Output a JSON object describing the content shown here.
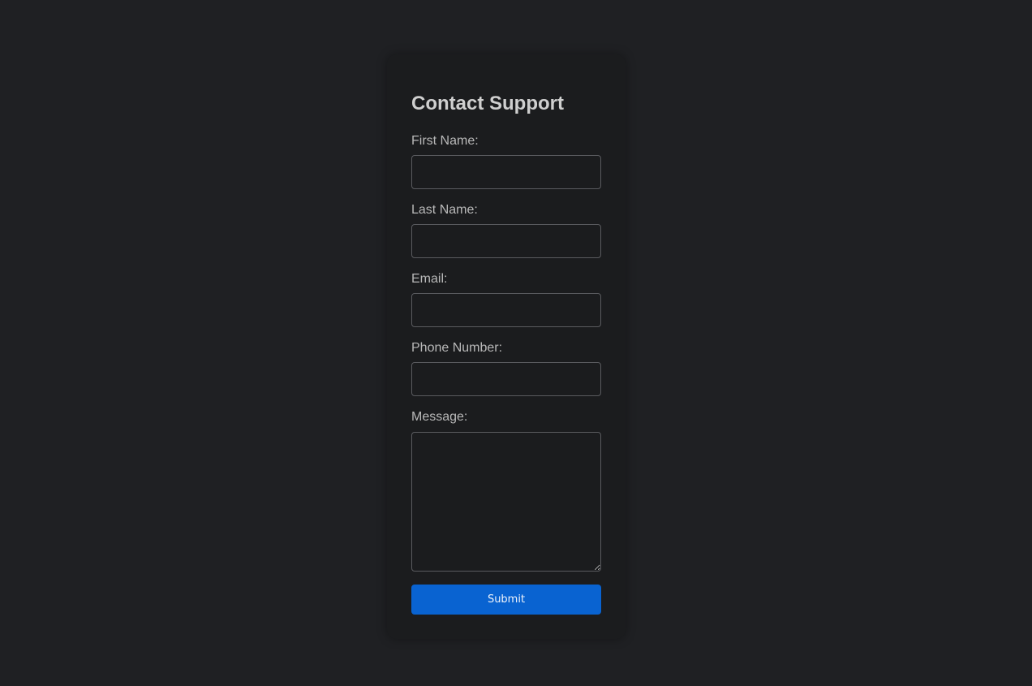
{
  "form": {
    "title": "Contact Support",
    "fields": {
      "first_name": {
        "label": "First Name:",
        "value": "",
        "placeholder": ""
      },
      "last_name": {
        "label": "Last Name:",
        "value": "",
        "placeholder": ""
      },
      "email": {
        "label": "Email:",
        "value": "",
        "placeholder": ""
      },
      "phone": {
        "label": "Phone Number:",
        "value": "",
        "placeholder": ""
      },
      "message": {
        "label": "Message:",
        "value": "",
        "placeholder": ""
      }
    },
    "submit_label": "Submit"
  },
  "colors": {
    "page_background": "#1f2023",
    "card_background": "#1b1c1e",
    "accent": "#0963d1",
    "input_border": "#5a5b5f",
    "label_text": "#b9b9b9",
    "title_text": "#cfcfcf"
  }
}
